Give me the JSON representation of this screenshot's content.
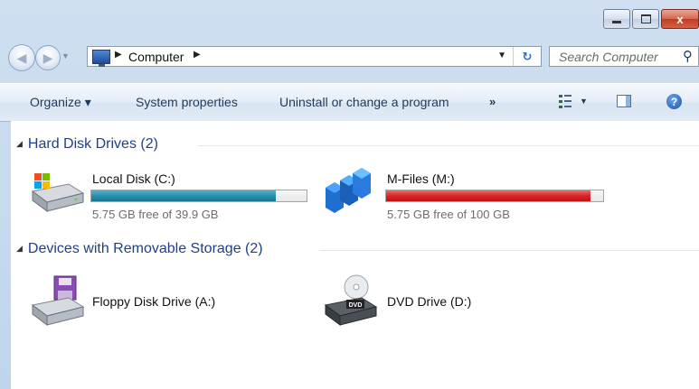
{
  "window": {
    "title_buttons": {
      "minimize": "",
      "maximize": "",
      "close": "x"
    }
  },
  "nav": {
    "address": {
      "location": "Computer"
    },
    "search": {
      "placeholder": "Search Computer"
    }
  },
  "toolbar": {
    "organize_label": "Organize ▾",
    "system_properties_label": "System properties",
    "uninstall_label": "Uninstall or change a program",
    "more_label": "»"
  },
  "groups": {
    "hard_disk": {
      "label": "Hard Disk Drives (2)",
      "drives": [
        {
          "name": "Local Disk (C:)",
          "free": "5.75 GB free of 39.9 GB",
          "used_fraction": 0.856,
          "status": "normal",
          "icon": "windows-hard-disk-icon"
        },
        {
          "name": "M-Files (M:)",
          "free": "5.75 GB free of 100 GB",
          "used_fraction": 0.9425,
          "status": "full",
          "icon": "m-files-icon"
        }
      ]
    },
    "removable": {
      "label": "Devices with Removable Storage (2)",
      "drives": [
        {
          "name": "Floppy Disk Drive (A:)",
          "icon": "floppy-drive-icon"
        },
        {
          "name": "DVD Drive (D:)",
          "icon": "dvd-drive-icon",
          "icon_text": "DVD"
        }
      ]
    }
  },
  "colors": {
    "bar_normal": "#26a0da",
    "bar_full": "#da2626",
    "group_header": "#1f3f8c",
    "command_text": "#1e395b"
  }
}
